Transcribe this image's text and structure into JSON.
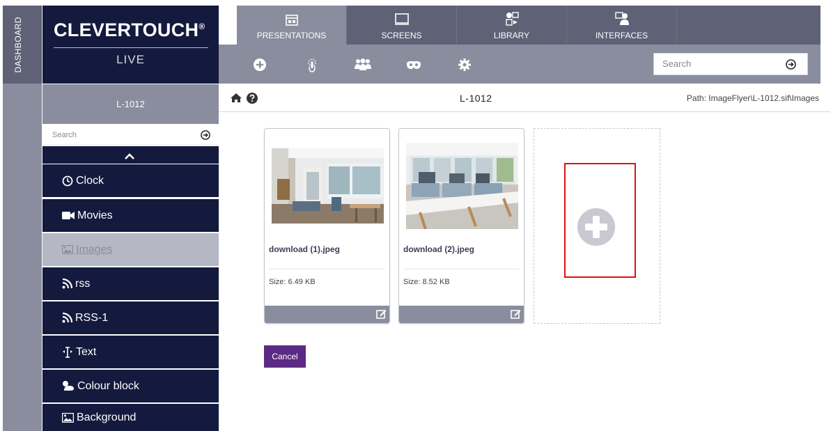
{
  "dashboard": {
    "label": "DASHBOARD"
  },
  "brand": {
    "name": "CLEVERTOUCH",
    "reg": "®",
    "sub": "LIVE"
  },
  "nav": {
    "tabs": [
      {
        "label": "PRESENTATIONS",
        "icon": "presentation-icon",
        "active": true
      },
      {
        "label": "SCREENS",
        "icon": "monitor-icon",
        "active": false
      },
      {
        "label": "LIBRARY",
        "icon": "library-icon",
        "active": false
      },
      {
        "label": "INTERFACES",
        "icon": "interfaces-icon",
        "active": false
      }
    ]
  },
  "toolbar": {
    "icons": [
      "plus-circle-icon",
      "touch-icon",
      "users-icon",
      "mask-icon",
      "gear-icon"
    ],
    "search_placeholder": "Search"
  },
  "left_menu": {
    "header": "L-1012",
    "search_placeholder": "Search",
    "items": [
      {
        "label": "Clock",
        "icon": "clock-icon"
      },
      {
        "label": "Movies",
        "icon": "video-camera-icon"
      },
      {
        "label": "Images",
        "icon": "image-icon",
        "selected": true
      },
      {
        "label": "rss",
        "icon": "rss-icon"
      },
      {
        "label": "RSS-1",
        "icon": "rss-icon"
      },
      {
        "label": "Text",
        "icon": "text-cursor-icon"
      },
      {
        "label": "Colour block",
        "icon": "paint-icon"
      },
      {
        "label": "Background",
        "icon": "picture-icon"
      }
    ]
  },
  "content": {
    "title": "L-1012",
    "path": "Path: ImageFlyer\\L-1012.sif\\Images",
    "cards": [
      {
        "filename": "download (1).jpeg",
        "size": "Size: 6.49 KB"
      },
      {
        "filename": "download (2).jpeg",
        "size": "Size: 8.52 KB"
      }
    ],
    "cancel_label": "Cancel"
  },
  "colors": {
    "navy": "#131a3d",
    "nav_gray": "#5f6276",
    "toolbar_gray": "#8a8d9d",
    "cancel_purple": "#5b2a84",
    "highlight_red": "#e01010"
  }
}
